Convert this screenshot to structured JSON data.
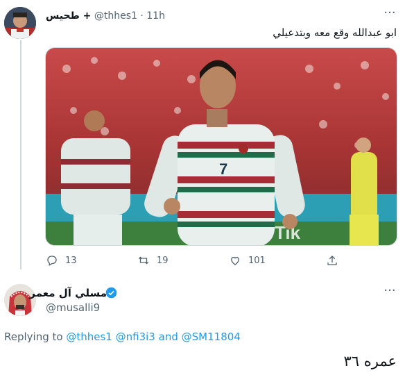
{
  "tweet1": {
    "display_name": "طحيس +",
    "handle": "@thhes1",
    "separator": "·",
    "time": "11h",
    "text": "ابو عبدالله وقع معه وبتدعيلي",
    "media_alt": "photo",
    "actions": {
      "replies": "13",
      "retweets": "19",
      "likes": "101"
    }
  },
  "tweet2": {
    "display_name": "مسلي آل معمر",
    "handle": "@musalli9",
    "replying_prefix": "Replying to",
    "mention_1": "@thhes1",
    "mention_2": "@nfi3i3",
    "and_text": "and",
    "mention_3": "@SM11804",
    "text": "عمره ٣٦"
  },
  "colors": {
    "accent": "#1d9bf0",
    "secondary_text": "#536471",
    "primary_text": "#0f1419",
    "thread_line": "#cfd9de"
  }
}
